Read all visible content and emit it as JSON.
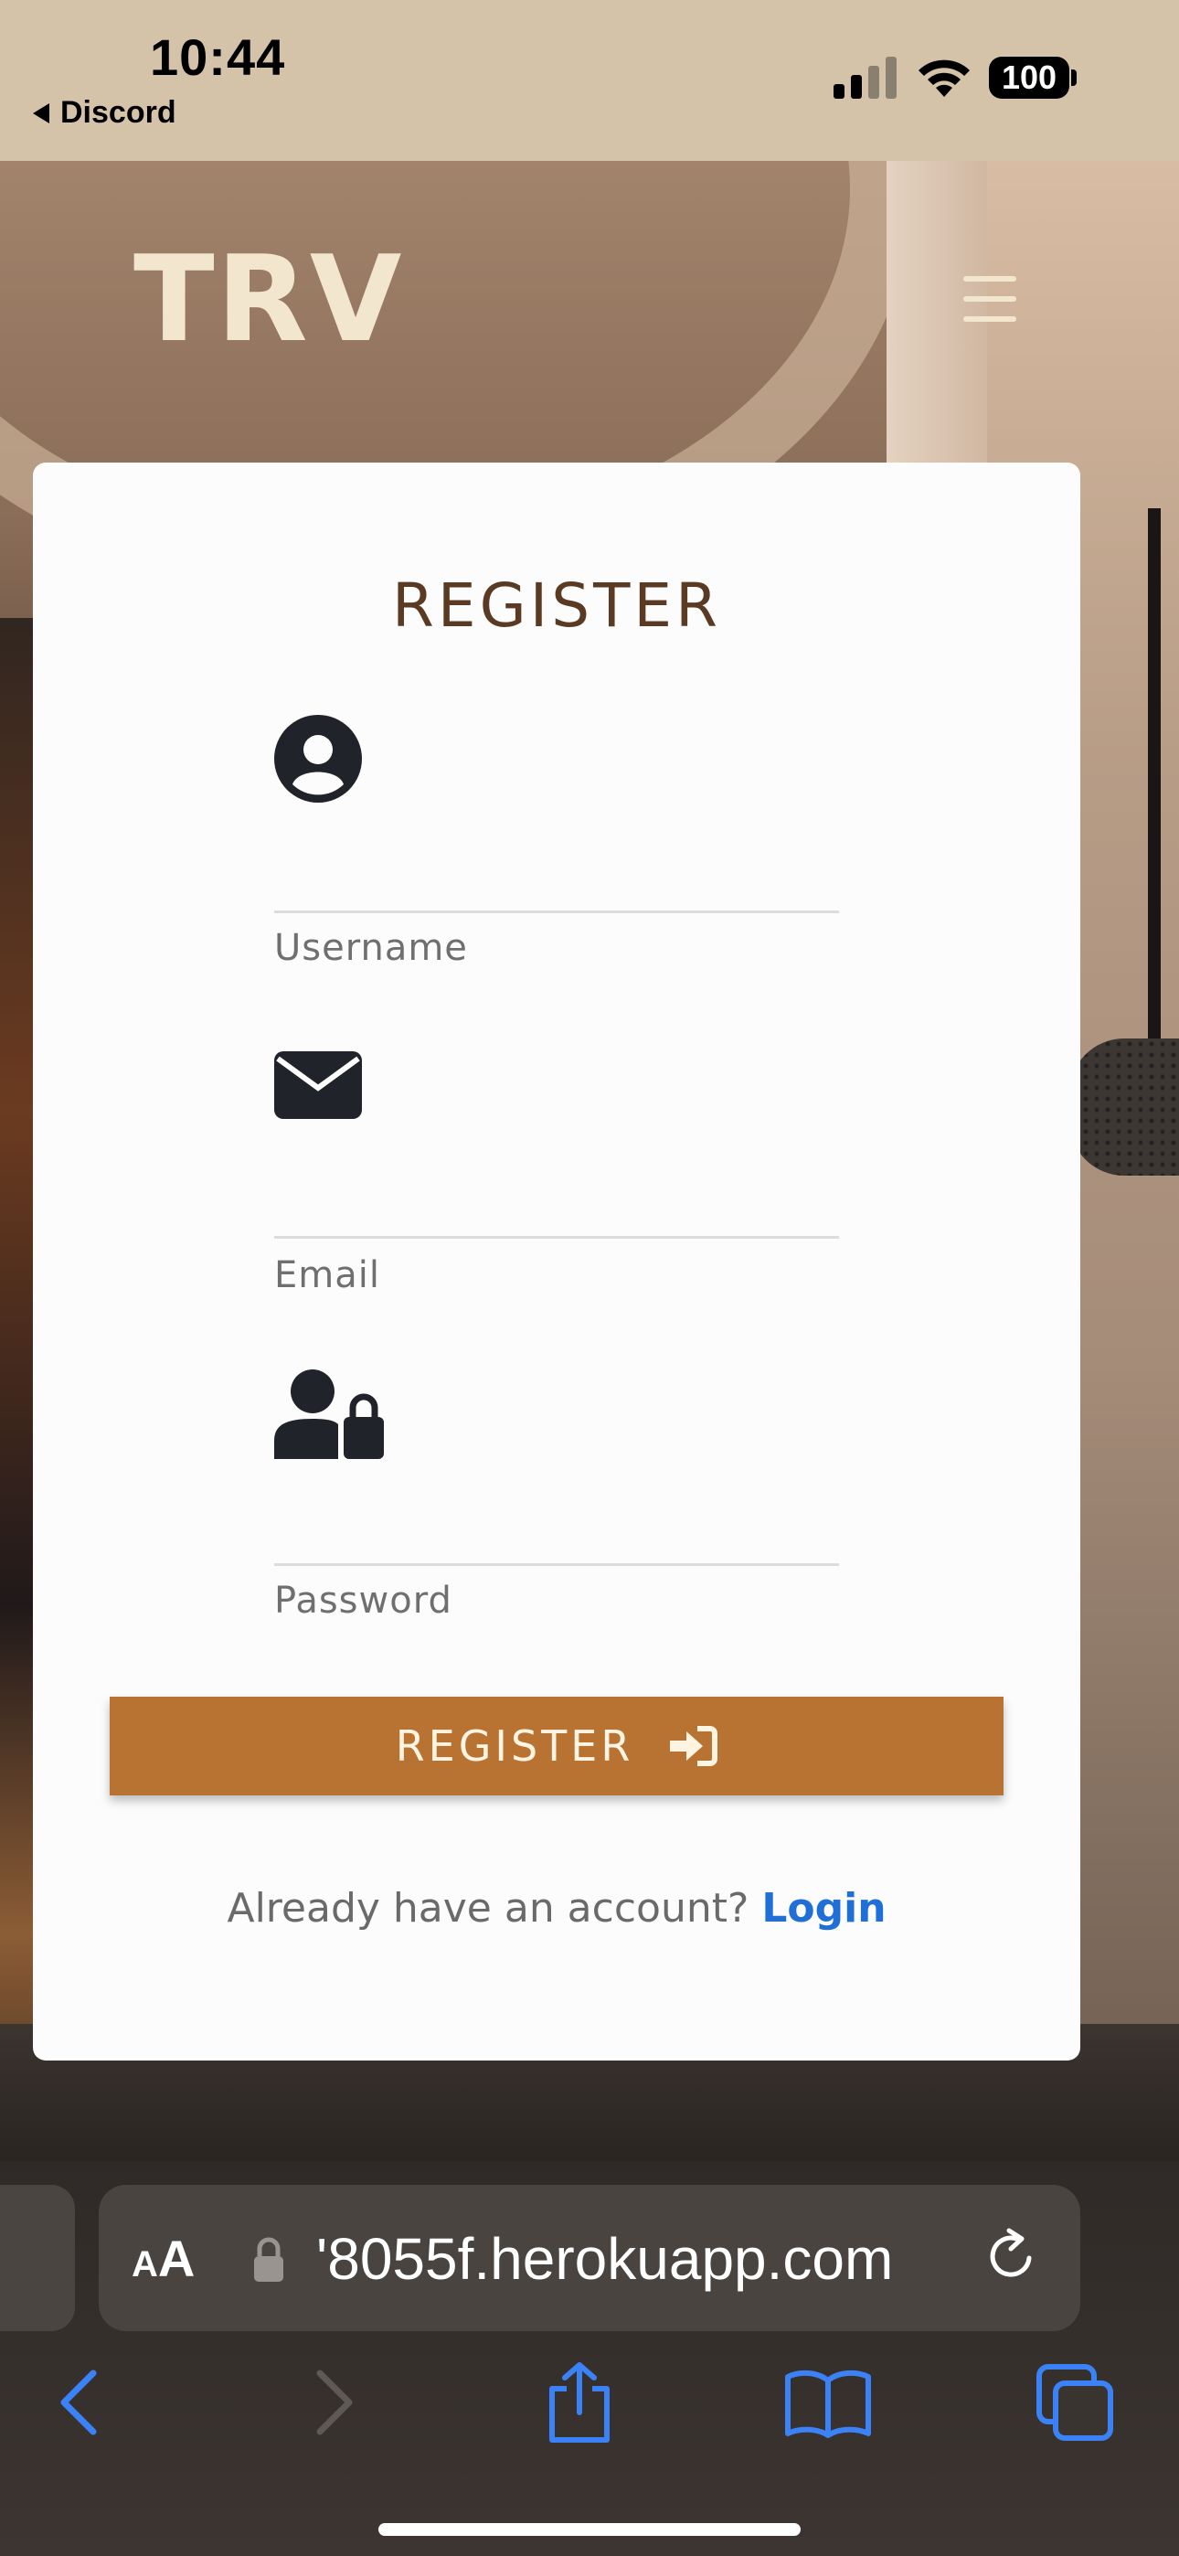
{
  "status_bar": {
    "time": "10:44",
    "back_app": "Discord",
    "battery": "100"
  },
  "header": {
    "brand": "TRV",
    "menu_icon": "hamburger-menu-icon"
  },
  "form": {
    "title": "REGISTER",
    "fields": [
      {
        "label": "Username",
        "icon": "user-circle-icon",
        "value": ""
      },
      {
        "label": "Email",
        "icon": "envelope-icon",
        "value": ""
      },
      {
        "label": "Password",
        "icon": "user-lock-icon",
        "value": ""
      }
    ],
    "submit_label": "REGISTER",
    "submit_icon": "sign-in-icon",
    "login_prompt": "Already have an account?",
    "login_link": "Login"
  },
  "browser": {
    "text_size_small": "A",
    "text_size_large": "A",
    "url": "'8055f.herokuapp.com",
    "toolbar": [
      "back-icon",
      "forward-icon",
      "share-icon",
      "bookmarks-icon",
      "tabs-icon"
    ]
  },
  "colors": {
    "accent": "#b87333",
    "title": "#5a3a23",
    "link": "#1f6fd6",
    "brand": "#f3e6cf",
    "status_bar_bg": "#d4c2a9"
  }
}
